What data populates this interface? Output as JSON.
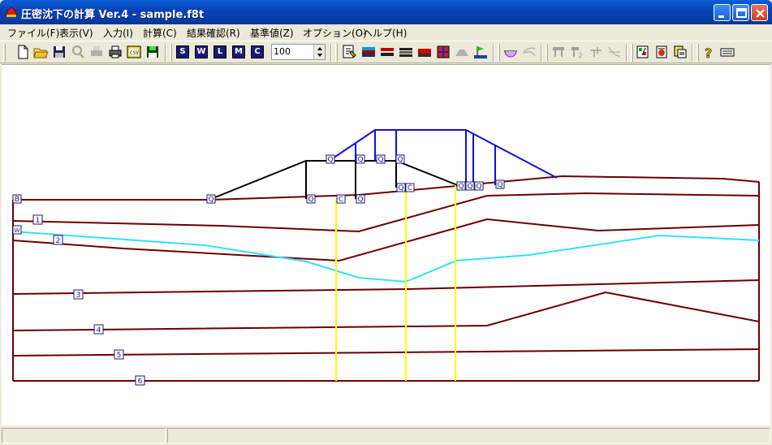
{
  "window": {
    "title": "圧密沈下の計算 Ver.4 - sample.f8t"
  },
  "menu": [
    "ファイル(F)",
    "表示(V)",
    "入力(I)",
    "計算(C)",
    "結果確認(R)",
    "基準値(Z)",
    "オプション(O)",
    "ヘルプ(H)"
  ],
  "toolbar": {
    "letter_buttons": [
      "S",
      "W",
      "L",
      "M",
      "C"
    ],
    "zoom_value": "100"
  },
  "drawing": {
    "labels": {
      "boundary": "B",
      "water": "W",
      "layers": [
        "1",
        "2",
        "3",
        "4",
        "5",
        "6"
      ],
      "load_marks": [
        "Q",
        "Q",
        "Q",
        "Q",
        "Q",
        "Q",
        "Q",
        "Q",
        "Q",
        "Q",
        "Q",
        "Q",
        "Q",
        "Q",
        "Q",
        "Q"
      ],
      "calc_mark": "C"
    },
    "colors": {
      "soil_layer": "#6b0000",
      "water_table": "#33e0ff",
      "embankment_upper": "#1010e0",
      "embankment_lower": "#000000",
      "calc_point": "#ffff00"
    }
  },
  "status": {
    "pane1": "",
    "pane2": ""
  }
}
